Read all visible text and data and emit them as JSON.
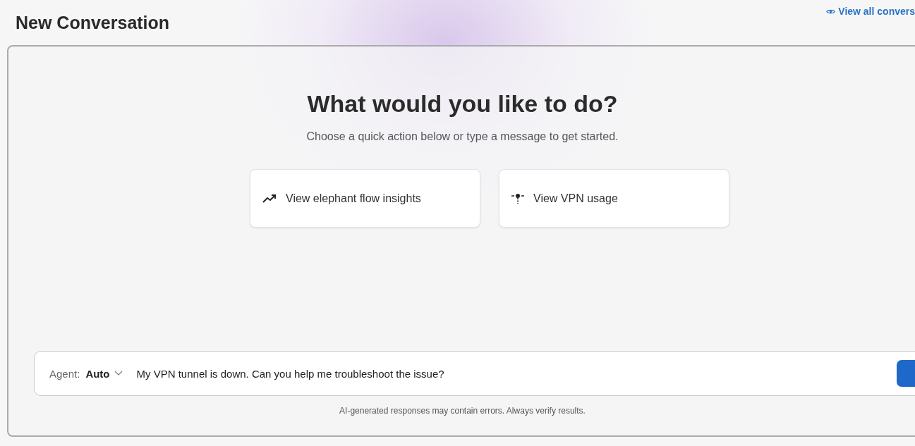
{
  "header": {
    "title": "New Conversation",
    "link": "View all convers"
  },
  "hero": {
    "heading": "What would you like to do?",
    "subtitle": "Choose a quick action below or type a message to get started."
  },
  "quick_actions": [
    {
      "kind": "trend",
      "label": "View elephant flow insights"
    },
    {
      "kind": "vpn",
      "label": "View VPN usage"
    }
  ],
  "composer": {
    "agent_label": "Agent:",
    "agent_value": "Auto",
    "value": "My VPN tunnel is down. Can you help me troubleshoot the issue?"
  },
  "disclaimer": "AI-generated responses may contain errors. Always verify results."
}
